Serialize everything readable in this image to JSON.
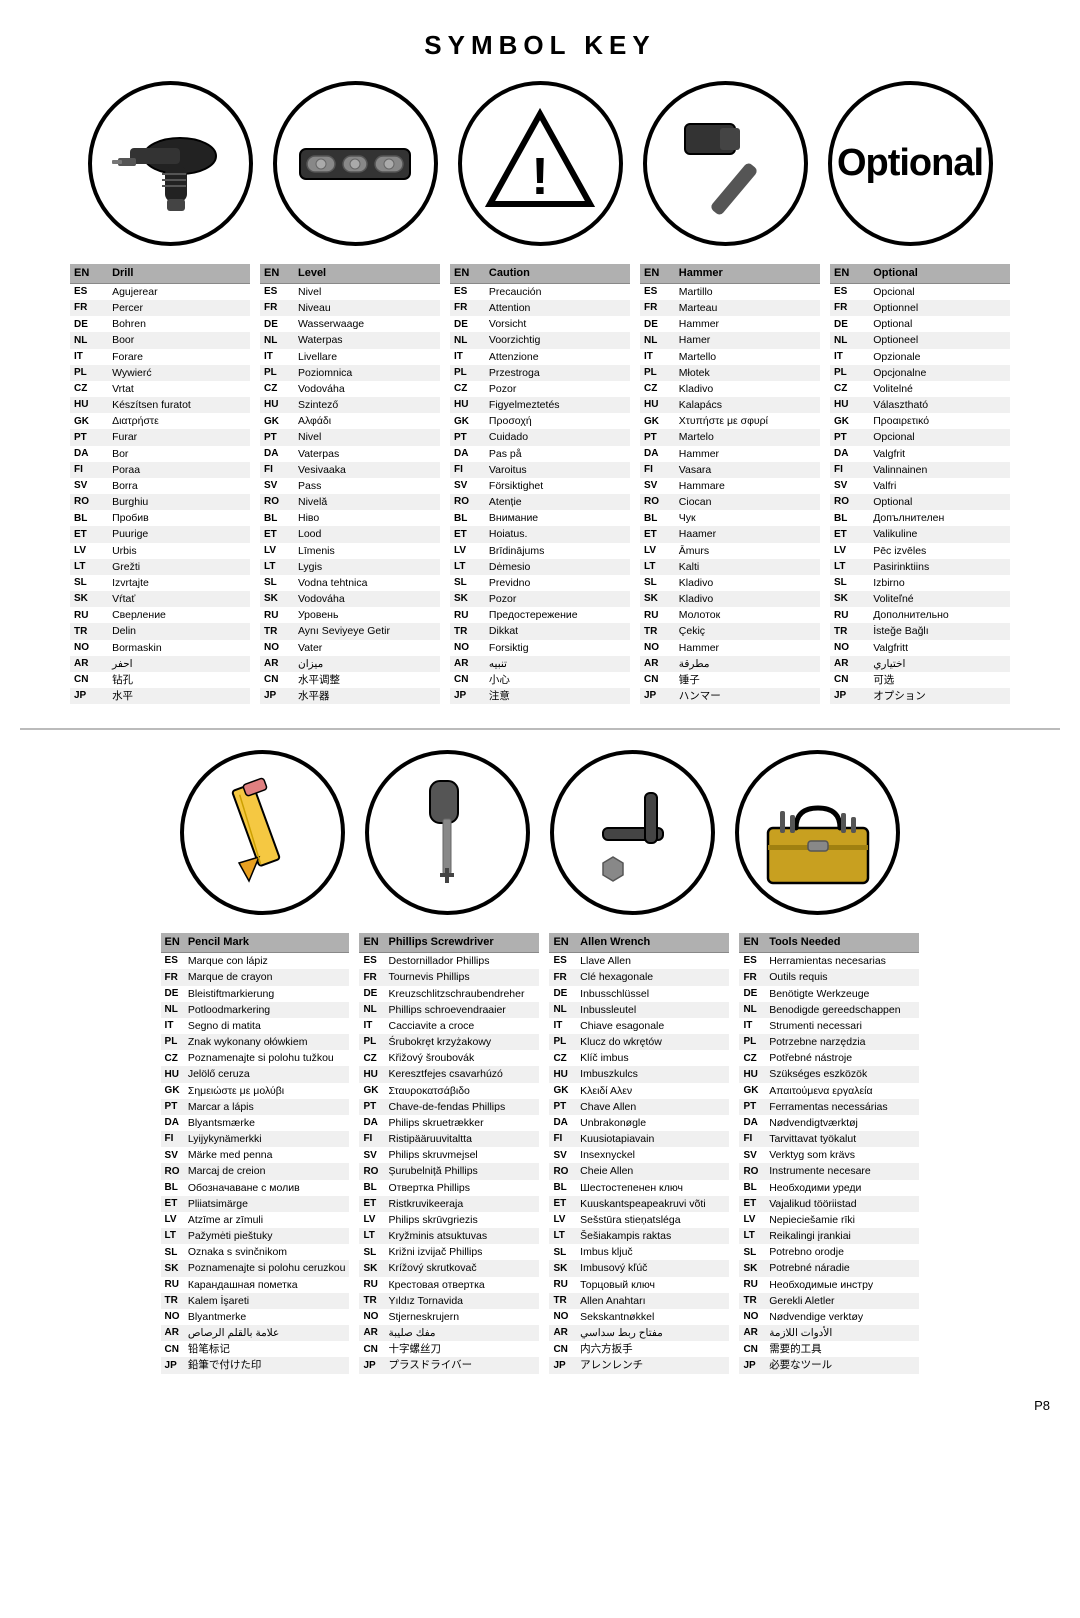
{
  "title": "SYMBOL KEY",
  "page": "P8",
  "icons": [
    {
      "name": "drill",
      "type": "drill"
    },
    {
      "name": "level",
      "type": "level"
    },
    {
      "name": "caution",
      "type": "caution"
    },
    {
      "name": "hammer",
      "type": "hammer"
    },
    {
      "name": "optional",
      "type": "opt"
    }
  ],
  "icons2": [
    {
      "name": "pencil",
      "type": "pencil"
    },
    {
      "name": "phillips",
      "type": "phillips"
    },
    {
      "name": "allen",
      "type": "allen"
    },
    {
      "name": "toolbox",
      "type": "toolbox"
    }
  ],
  "tables": [
    {
      "id": "drill",
      "header_lang": "EN",
      "header_word": "Drill",
      "rows": [
        [
          "ES",
          "Agujerear"
        ],
        [
          "FR",
          "Percer"
        ],
        [
          "DE",
          "Bohren"
        ],
        [
          "NL",
          "Boor"
        ],
        [
          "IT",
          "Forare"
        ],
        [
          "PL",
          "Wywierć"
        ],
        [
          "CZ",
          "Vrtat"
        ],
        [
          "HU",
          "Készítsen furatot"
        ],
        [
          "GK",
          "Διατρήστε"
        ],
        [
          "PT",
          "Furar"
        ],
        [
          "DA",
          "Bor"
        ],
        [
          "FI",
          "Poraa"
        ],
        [
          "SV",
          "Borra"
        ],
        [
          "RO",
          "Burghiu"
        ],
        [
          "BL",
          "Пробив"
        ],
        [
          "ET",
          "Puurige"
        ],
        [
          "LV",
          "Urbis"
        ],
        [
          "LT",
          "Grežti"
        ],
        [
          "SL",
          "Izvrtajte"
        ],
        [
          "SK",
          "Vŕtať"
        ],
        [
          "RU",
          "Сверление"
        ],
        [
          "TR",
          "Delin"
        ],
        [
          "NO",
          "Bormaskin"
        ],
        [
          "AR",
          "احفر"
        ],
        [
          "CN",
          "钻孔"
        ],
        [
          "JP",
          "水平"
        ]
      ]
    },
    {
      "id": "level",
      "header_lang": "EN",
      "header_word": "Level",
      "rows": [
        [
          "ES",
          "Nivel"
        ],
        [
          "FR",
          "Niveau"
        ],
        [
          "DE",
          "Wasserwaage"
        ],
        [
          "NL",
          "Waterpas"
        ],
        [
          "IT",
          "Livellare"
        ],
        [
          "PL",
          "Poziomnica"
        ],
        [
          "CZ",
          "Vodováha"
        ],
        [
          "HU",
          "Szintező"
        ],
        [
          "GK",
          "Αλφάδι"
        ],
        [
          "PT",
          "Nivel"
        ],
        [
          "DA",
          "Vaterpas"
        ],
        [
          "FI",
          "Vesivaaka"
        ],
        [
          "SV",
          "Pass"
        ],
        [
          "RO",
          "Nivelă"
        ],
        [
          "BL",
          "Нiво"
        ],
        [
          "ET",
          "Lood"
        ],
        [
          "LV",
          "Līmenis"
        ],
        [
          "LT",
          "Lygis"
        ],
        [
          "SL",
          "Vodna tehtnica"
        ],
        [
          "SK",
          "Vodováha"
        ],
        [
          "RU",
          "Уровень"
        ],
        [
          "TR",
          "Aynı Seviyeye Getir"
        ],
        [
          "NO",
          "Vater"
        ],
        [
          "AR",
          "ميزان"
        ],
        [
          "CN",
          "水平调整"
        ],
        [
          "JP",
          "水平器"
        ]
      ]
    },
    {
      "id": "caution",
      "header_lang": "EN",
      "header_word": "Caution",
      "rows": [
        [
          "ES",
          "Precaución"
        ],
        [
          "FR",
          "Attention"
        ],
        [
          "DE",
          "Vorsicht"
        ],
        [
          "NL",
          "Voorzichtig"
        ],
        [
          "IT",
          "Attenzione"
        ],
        [
          "PL",
          "Przestroga"
        ],
        [
          "CZ",
          "Pozor"
        ],
        [
          "HU",
          "Figyelmeztetés"
        ],
        [
          "GK",
          "Προσοχή"
        ],
        [
          "PT",
          "Cuidado"
        ],
        [
          "DA",
          "Pas på"
        ],
        [
          "FI",
          "Varoitus"
        ],
        [
          "SV",
          "Försiktighet"
        ],
        [
          "RO",
          "Atenție"
        ],
        [
          "BL",
          "Внимание"
        ],
        [
          "ET",
          "Hoiatus."
        ],
        [
          "LV",
          "Brīdinājums"
        ],
        [
          "LT",
          "Dėmesio"
        ],
        [
          "SL",
          "Previdno"
        ],
        [
          "SK",
          "Pozor"
        ],
        [
          "RU",
          "Предостережение"
        ],
        [
          "TR",
          "Dikkat"
        ],
        [
          "NO",
          "Forsiktig"
        ],
        [
          "AR",
          "تنبيه"
        ],
        [
          "CN",
          "小心"
        ],
        [
          "JP",
          "注意"
        ]
      ]
    },
    {
      "id": "hammer",
      "header_lang": "EN",
      "header_word": "Hammer",
      "rows": [
        [
          "ES",
          "Martillo"
        ],
        [
          "FR",
          "Marteau"
        ],
        [
          "DE",
          "Hammer"
        ],
        [
          "NL",
          "Hamer"
        ],
        [
          "IT",
          "Martello"
        ],
        [
          "PL",
          "Młotek"
        ],
        [
          "CZ",
          "Kladivo"
        ],
        [
          "HU",
          "Kalapács"
        ],
        [
          "GK",
          "Χτυπήστε με σφυρί"
        ],
        [
          "PT",
          "Martelo"
        ],
        [
          "DA",
          "Hammer"
        ],
        [
          "FI",
          "Vasara"
        ],
        [
          "SV",
          "Hammare"
        ],
        [
          "RO",
          "Ciocan"
        ],
        [
          "BL",
          "Чук"
        ],
        [
          "ET",
          "Haamer"
        ],
        [
          "LV",
          "Āmurs"
        ],
        [
          "LT",
          "Kalti"
        ],
        [
          "SL",
          "Kladivo"
        ],
        [
          "SK",
          "Kladivo"
        ],
        [
          "RU",
          "Молоток"
        ],
        [
          "TR",
          "Çekiç"
        ],
        [
          "NO",
          "Hammer"
        ],
        [
          "AR",
          "مطرقة"
        ],
        [
          "CN",
          "锤子"
        ],
        [
          "JP",
          "ハンマー"
        ]
      ]
    },
    {
      "id": "optional",
      "header_lang": "EN",
      "header_word": "Optional",
      "rows": [
        [
          "ES",
          "Opcional"
        ],
        [
          "FR",
          "Optionnel"
        ],
        [
          "DE",
          "Optional"
        ],
        [
          "NL",
          "Optioneel"
        ],
        [
          "IT",
          "Opzionale"
        ],
        [
          "PL",
          "Opcjonalne"
        ],
        [
          "CZ",
          "Volitelné"
        ],
        [
          "HU",
          "Választható"
        ],
        [
          "GK",
          "Προαιρετικό"
        ],
        [
          "PT",
          "Opcional"
        ],
        [
          "DA",
          "Valgfrit"
        ],
        [
          "FI",
          "Valinnainen"
        ],
        [
          "SV",
          "Valfri"
        ],
        [
          "RO",
          "Optional"
        ],
        [
          "BL",
          "Допълнителен"
        ],
        [
          "ET",
          "Valikuline"
        ],
        [
          "LV",
          "Pēc izvēles"
        ],
        [
          "LT",
          "Pasirinktiins"
        ],
        [
          "SL",
          "Izbirno"
        ],
        [
          "SK",
          "Voliteľné"
        ],
        [
          "RU",
          "Дополнительно"
        ],
        [
          "TR",
          "İsteğe Bağlı"
        ],
        [
          "NO",
          "Valgfritt"
        ],
        [
          "AR",
          "اختياري"
        ],
        [
          "CN",
          "可选"
        ],
        [
          "JP",
          "オプション"
        ]
      ]
    }
  ],
  "tables2": [
    {
      "id": "pencil",
      "header_lang": "EN",
      "header_word": "Pencil Mark",
      "rows": [
        [
          "ES",
          "Marque con lápiz"
        ],
        [
          "FR",
          "Marque de crayon"
        ],
        [
          "DE",
          "Bleistiftmarkierung"
        ],
        [
          "NL",
          "Potloodmarkering"
        ],
        [
          "IT",
          "Segno di matita"
        ],
        [
          "PL",
          "Znak wykonany ołówkiem"
        ],
        [
          "CZ",
          "Poznamenajte si polohu tužkou"
        ],
        [
          "HU",
          "Jelölő ceruza"
        ],
        [
          "GK",
          "Σημειώστε με μολύβι"
        ],
        [
          "PT",
          "Marcar a lápis"
        ],
        [
          "DA",
          "Blyantsmærke"
        ],
        [
          "FI",
          "Lyijykynämerkki"
        ],
        [
          "SV",
          "Märke med penna"
        ],
        [
          "RO",
          "Marcaj de creion"
        ],
        [
          "BL",
          "Обозначаване с молив"
        ],
        [
          "ET",
          "Pliiatsimärge"
        ],
        [
          "LV",
          "Atzīme ar zīmuli"
        ],
        [
          "LT",
          "Pažymėti pieštuky"
        ],
        [
          "SL",
          "Oznaka s svinčnikom"
        ],
        [
          "SK",
          "Poznamenajte si polohu ceruzkou"
        ],
        [
          "RU",
          "Карандашная пометка"
        ],
        [
          "TR",
          "Kalem İşareti"
        ],
        [
          "NO",
          "Blyantmerke"
        ],
        [
          "AR",
          "علامة بالقلم الرصاص"
        ],
        [
          "CN",
          "铅笔标记"
        ],
        [
          "JP",
          "鉛筆で付けた印"
        ]
      ]
    },
    {
      "id": "phillips",
      "header_lang": "EN",
      "header_word": "Phillips Screwdriver",
      "rows": [
        [
          "ES",
          "Destornillador Phillips"
        ],
        [
          "FR",
          "Tournevis Phillips"
        ],
        [
          "DE",
          "Kreuzschlitzschraubendreher"
        ],
        [
          "NL",
          "Phillips schroevendraaier"
        ],
        [
          "IT",
          "Cacciavite a croce"
        ],
        [
          "PL",
          "Śrubokręt krzyżakowy"
        ],
        [
          "CZ",
          "Křižový šroubovák"
        ],
        [
          "HU",
          "Keresztfejes csavarhúzó"
        ],
        [
          "GK",
          "Σταυροκατσάβιδο"
        ],
        [
          "PT",
          "Chave-de-fendas Phillips"
        ],
        [
          "DA",
          "Philips skruetrækker"
        ],
        [
          "FI",
          "Ristipääruuvitaltta"
        ],
        [
          "SV",
          "Philips skruvmejsel"
        ],
        [
          "RO",
          "Șurubelniță Phillips"
        ],
        [
          "BL",
          "Отвертка Phillips"
        ],
        [
          "ET",
          "Ristkruvikeeraja"
        ],
        [
          "LV",
          "Philips skrūvgriezis"
        ],
        [
          "LT",
          "Kryžminis atsuktuvas"
        ],
        [
          "SL",
          "Križni izvijač Phillips"
        ],
        [
          "SK",
          "Krížový skrutkovač"
        ],
        [
          "RU",
          "Крестовая отвертка"
        ],
        [
          "TR",
          "Yıldız Tornavida"
        ],
        [
          "NO",
          "Stjerneskrujern"
        ],
        [
          "AR",
          "مفك صليبة"
        ],
        [
          "CN",
          "十字螺丝刀"
        ],
        [
          "JP",
          "プラスドライバー"
        ]
      ]
    },
    {
      "id": "allen",
      "header_lang": "EN",
      "header_word": "Allen Wrench",
      "rows": [
        [
          "ES",
          "Llave Allen"
        ],
        [
          "FR",
          "Clé hexagonale"
        ],
        [
          "DE",
          "Inbusschlüssel"
        ],
        [
          "NL",
          "Inbussleutel"
        ],
        [
          "IT",
          "Chiave esagonale"
        ],
        [
          "PL",
          "Klucz do wkrętów"
        ],
        [
          "CZ",
          "Klíč imbus"
        ],
        [
          "HU",
          "Imbuszkulcs"
        ],
        [
          "GK",
          "Κλειδί Αλεν"
        ],
        [
          "PT",
          "Chave Allen"
        ],
        [
          "DA",
          "Unbrakonøgle"
        ],
        [
          "FI",
          "Kuusiotapiavain"
        ],
        [
          "SV",
          "Insexnyckel"
        ],
        [
          "RO",
          "Cheie Allen"
        ],
        [
          "BL",
          "Шестостепенен ключ"
        ],
        [
          "ET",
          "Kuuskantspeapeakruvi võti"
        ],
        [
          "LV",
          "Sešstūra stieņatsléga"
        ],
        [
          "LT",
          "Šešiakampis raktas"
        ],
        [
          "SL",
          "Imbus ključ"
        ],
        [
          "SK",
          "Imbusový kľúč"
        ],
        [
          "RU",
          "Торцовый ключ"
        ],
        [
          "TR",
          "Allen Anahtarı"
        ],
        [
          "NO",
          "Sekskantnøkkel"
        ],
        [
          "AR",
          "مفتاح ربط سداسي"
        ],
        [
          "CN",
          "内六方扳手"
        ],
        [
          "JP",
          "アレンレンチ"
        ]
      ]
    },
    {
      "id": "toolsneeded",
      "header_lang": "EN",
      "header_word": "Tools Needed",
      "rows": [
        [
          "ES",
          "Herramientas necesarias"
        ],
        [
          "FR",
          "Outils requis"
        ],
        [
          "DE",
          "Benötigte Werkzeuge"
        ],
        [
          "NL",
          "Benodigde gereedschappen"
        ],
        [
          "IT",
          "Strumenti necessari"
        ],
        [
          "PL",
          "Potrzebne narzędzia"
        ],
        [
          "CZ",
          "Potřebné nástroje"
        ],
        [
          "HU",
          "Szükséges eszközök"
        ],
        [
          "GK",
          "Απαιτούμενα εργαλεία"
        ],
        [
          "PT",
          "Ferramentas necessárias"
        ],
        [
          "DA",
          "Nødvendigtværktøj"
        ],
        [
          "FI",
          "Tarvittavat työkalut"
        ],
        [
          "SV",
          "Verktyg som krävs"
        ],
        [
          "RO",
          "Instrumente necesare"
        ],
        [
          "BL",
          "Необходими уреди"
        ],
        [
          "ET",
          "Vajalikud tööriistad"
        ],
        [
          "LV",
          "Nepieciešamie rīki"
        ],
        [
          "LT",
          "Reikalingi įrankiai"
        ],
        [
          "SL",
          "Potrebno orodje"
        ],
        [
          "SK",
          "Potrebné náradie"
        ],
        [
          "RU",
          "Необходимые инстру"
        ],
        [
          "TR",
          "Gerekli Aletler"
        ],
        [
          "NO",
          "Nødvendige verktøy"
        ],
        [
          "AR",
          "الأدوات اللازمة"
        ],
        [
          "CN",
          "需要的工具"
        ],
        [
          "JP",
          "必要なツール"
        ]
      ]
    }
  ]
}
